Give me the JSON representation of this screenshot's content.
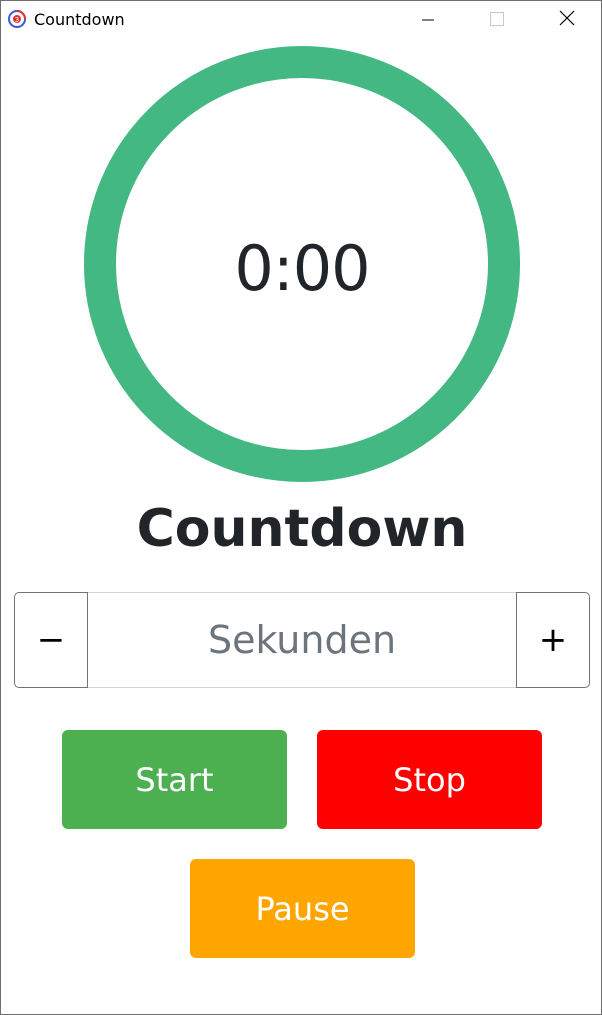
{
  "window": {
    "title": "Countdown",
    "controls": [
      "minimize",
      "maximize",
      "close"
    ]
  },
  "timer": {
    "display": "0:00",
    "ring_progress": 1.0,
    "ring_color": "#43b883"
  },
  "heading": "Countdown",
  "seconds_input": {
    "value": "",
    "placeholder": "Sekunden",
    "decrement_label": "−",
    "increment_label": "+"
  },
  "buttons": {
    "start": {
      "label": "Start",
      "color": "#4caf50"
    },
    "stop": {
      "label": "Stop",
      "color": "#ff0000"
    },
    "pause": {
      "label": "Pause",
      "color": "#ffa500"
    }
  },
  "icons": {
    "app": "app-icon",
    "minimize": "minimize-icon",
    "maximize": "maximize-icon",
    "close": "close-icon"
  }
}
